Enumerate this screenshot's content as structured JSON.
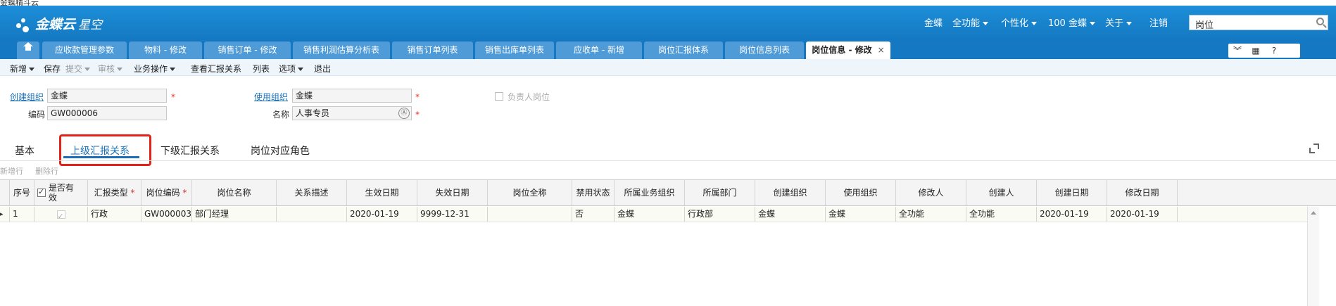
{
  "window": {
    "caption": "金蝶精斗云"
  },
  "header": {
    "logo_main": "金蝶云",
    "logo_sub": "星空",
    "org": "金蝶",
    "all_functions": "全功能",
    "personalize": "个性化",
    "account": "100 金蝶",
    "about": "关于",
    "logout": "注销",
    "search_value": "岗位"
  },
  "tabs": [
    {
      "label": "应收款管理参数"
    },
    {
      "label": "物料 - 修改"
    },
    {
      "label": "销售订单 - 修改"
    },
    {
      "label": "销售利润估算分析表"
    },
    {
      "label": "销售订单列表"
    },
    {
      "label": "销售出库单列表"
    },
    {
      "label": "应收单 - 新增"
    },
    {
      "label": "岗位汇报体系"
    },
    {
      "label": "岗位信息列表"
    },
    {
      "label": "岗位信息 - 修改",
      "close": "×"
    }
  ],
  "toolbar": {
    "new": "新增",
    "save": "保存",
    "submit": "提交",
    "audit": "审核",
    "business_ops": "业务操作",
    "view_report": "查看汇报关系",
    "list": "列表",
    "options": "选项",
    "exit": "退出"
  },
  "form": {
    "create_org_label": "创建组织",
    "create_org_value": "金蝶",
    "use_org_label": "使用组织",
    "use_org_value": "金蝶",
    "leader_post_label": "负责人岗位",
    "code_label": "编码",
    "code_value": "GW000006",
    "name_label": "名称",
    "name_value": "人事专员",
    "required_mark": "*",
    "multilang_icon": "Ⓐ"
  },
  "subtabs": {
    "basic": "基本",
    "upper": "上级汇报关系",
    "lower": "下级汇报关系",
    "roles": "岗位对应角色"
  },
  "row_tools": {
    "add_row": "新增行",
    "delete_row": "删除行"
  },
  "grid": {
    "headers": {
      "seq": "序号",
      "valid": "是否有效",
      "report_type": "汇报类型",
      "post_code": "岗位编码",
      "post_name": "岗位名称",
      "relation_desc": "关系描述",
      "effective_date": "生效日期",
      "expire_date": "失效日期",
      "post_fullname": "岗位全称",
      "disabled": "禁用状态",
      "business_org": "所属业务组织",
      "department": "所属部门",
      "create_org": "创建组织",
      "use_org": "使用组织",
      "modifier": "修改人",
      "creator": "创建人",
      "create_date": "创建日期",
      "modify_date": "修改日期"
    },
    "rows": [
      {
        "seq": "1",
        "report_type": "行政",
        "post_code": "GW000003",
        "post_name": "部门经理",
        "relation_desc": "",
        "effective_date": "2020-01-19",
        "expire_date": "9999-12-31",
        "post_fullname": "",
        "disabled": "否",
        "business_org": "金蝶",
        "department": "行政部",
        "create_org": "金蝶",
        "use_org": "金蝶",
        "modifier": "全功能",
        "creator": "全功能",
        "create_date": "2020-01-19",
        "modify_date": "2020-01-19"
      }
    ]
  },
  "colors": {
    "header_blue": "#1479c2",
    "tab_blue": "#4e9bd8",
    "highlight_red": "#e2231a",
    "link_blue": "#1a6fb5"
  }
}
